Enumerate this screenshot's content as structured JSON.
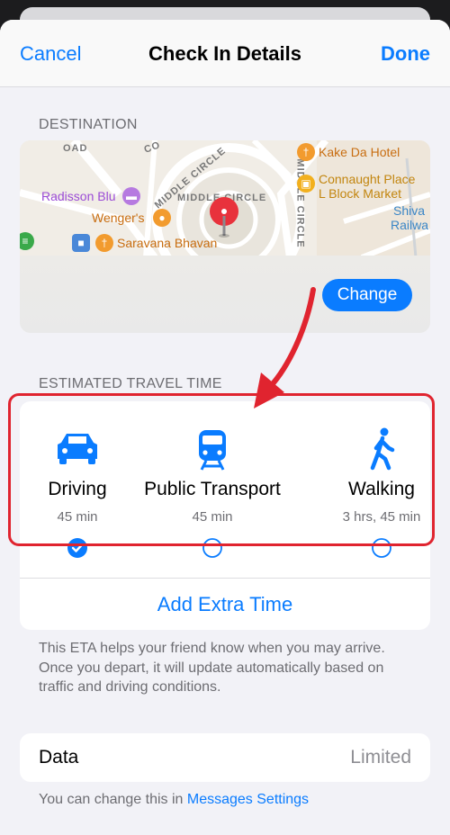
{
  "nav": {
    "cancel": "Cancel",
    "title": "Check In Details",
    "done": "Done"
  },
  "destination": {
    "header": "DESTINATION",
    "map_labels": {
      "kake_da_hotel": "Kake Da Hotel",
      "connaught_place": "Connaught Place",
      "l_block_market": "L Block Market",
      "radisson_blu": "Radisson Blu",
      "wengers": "Wenger's",
      "saravana_bhavan": "Saravana Bhavan",
      "shiva": "Shiva",
      "railwa": "Railwa",
      "middle_circle_1": "MIDDLE CIRCLE",
      "middle_circle_2": "MIDDLE CIRCLE",
      "middle_circle_3": "MIDDLE CIRCLE",
      "road_ad": "OAD",
      "road_co": "CO"
    },
    "change_label": "Change"
  },
  "travel": {
    "header": "ESTIMATED TRAVEL TIME",
    "modes": [
      {
        "label": "Driving",
        "time": "45 min",
        "icon": "car-icon",
        "selected": true
      },
      {
        "label": "Public Transport",
        "time": "45 min",
        "icon": "train-icon",
        "selected": false
      },
      {
        "label": "Walking",
        "time": "3 hrs, 45 min",
        "icon": "walking-icon",
        "selected": false
      }
    ],
    "add_extra_time": "Add Extra Time",
    "footnote": "This ETA helps your friend know when you may arrive. Once you depart, it will update automatically based on traffic and driving conditions."
  },
  "data_row": {
    "label": "Data",
    "value": "Limited"
  },
  "footer": {
    "prefix": "You can change this in ",
    "link": "Messages Settings"
  },
  "colors": {
    "accent": "#0a7cff",
    "annotation": "#e0242f",
    "pin": "#e8323c"
  }
}
